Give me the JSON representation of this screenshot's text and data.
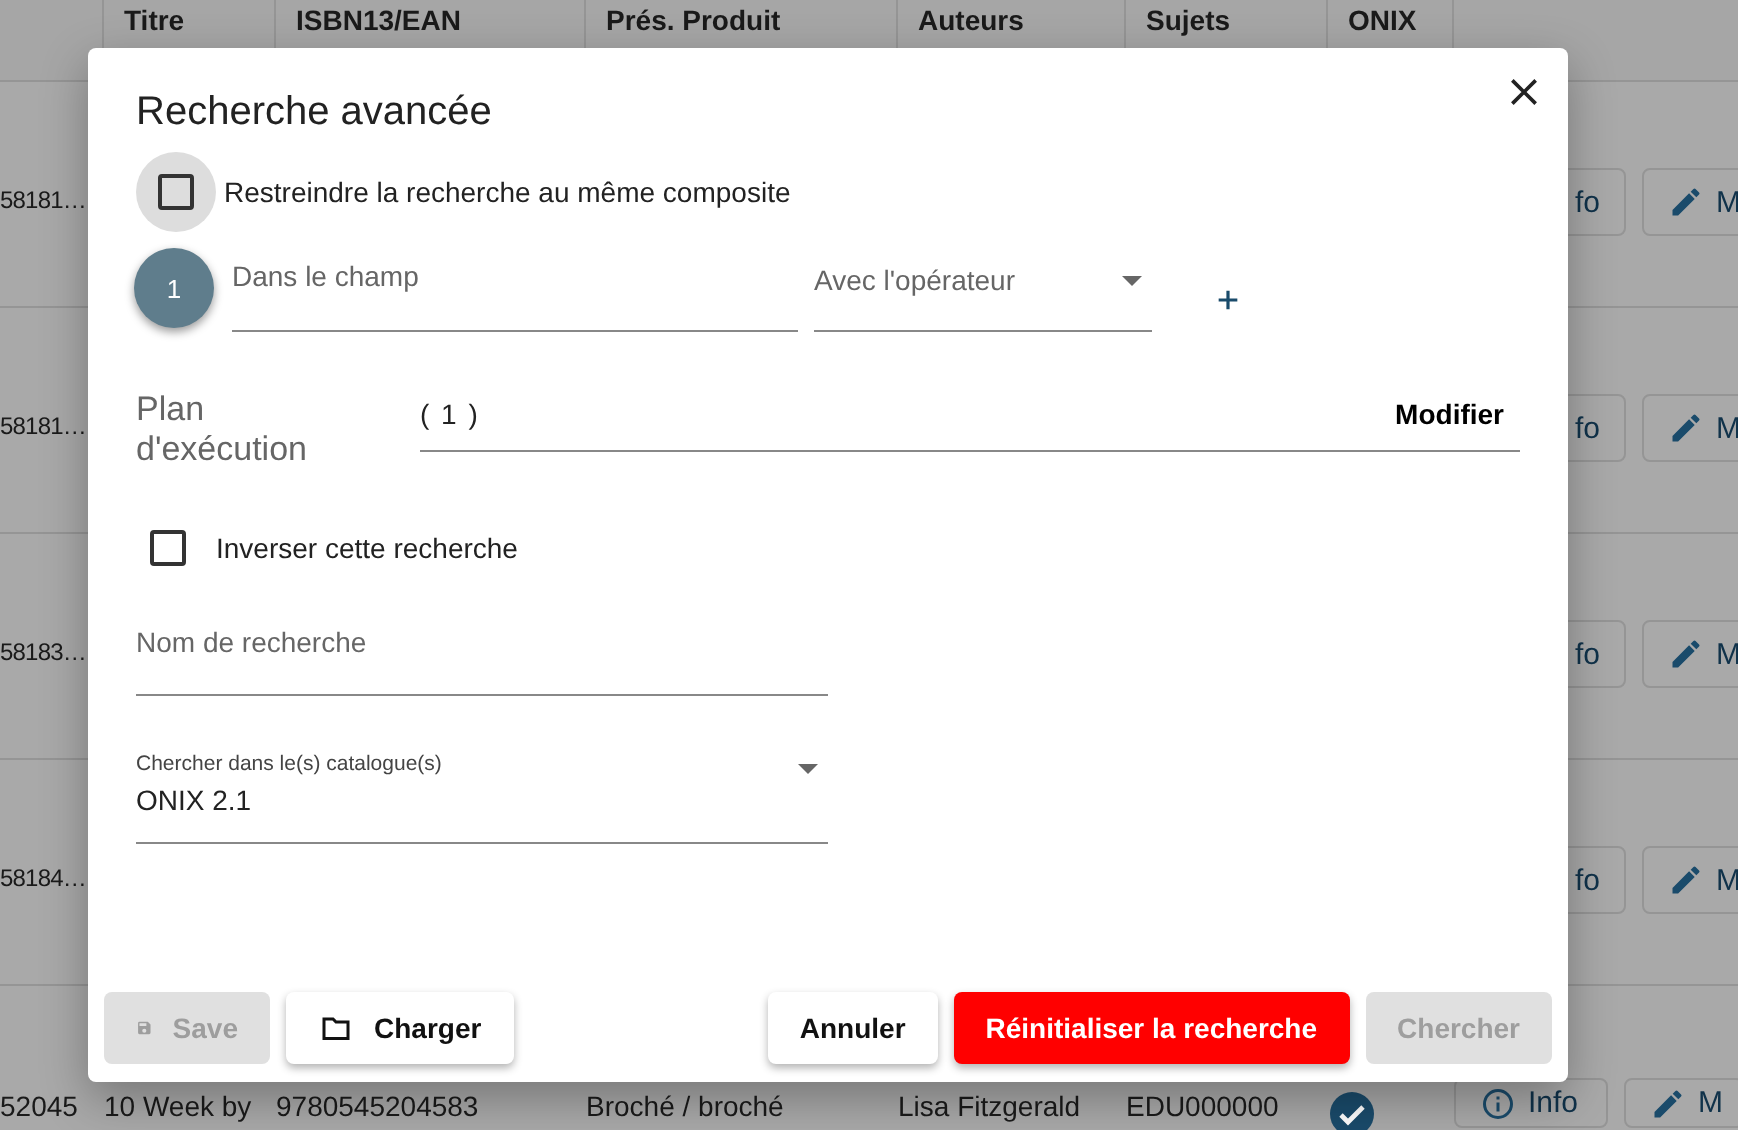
{
  "table": {
    "columns": [
      "Titre",
      "ISBN13/EAN",
      "Prés. Produit",
      "Auteurs",
      "Sujets",
      "ONIX"
    ],
    "rows": [
      {
        "code": "58181…",
        "info_button": "fo",
        "edit_button": "M"
      },
      {
        "code": "58181…",
        "info_button": "fo",
        "edit_button": "M"
      },
      {
        "code": "58183…",
        "info_button": "fo",
        "edit_button": "M"
      },
      {
        "code": "58184…",
        "info_button": "fo",
        "edit_button": "M"
      }
    ],
    "last_row": {
      "cells": [
        "52045",
        "10 Week by",
        "9780545204583",
        "Broché / broché",
        "Lisa Fitzgerald",
        "EDU000000"
      ],
      "onix_checked": true,
      "info_button": "Info",
      "edit_button": "M"
    }
  },
  "dialog": {
    "title": "Recherche avancée",
    "restrict_checkbox": {
      "label": "Restreindre la recherche au même composite",
      "checked": false
    },
    "conditions": [
      {
        "step": "1",
        "field": {
          "placeholder": "Dans le champ"
        },
        "operator_select": {
          "label": "Avec l'opérateur"
        }
      }
    ],
    "plan": {
      "label": "Plan d'exécution",
      "value": "( 1 )",
      "modify_button": "Modifier"
    },
    "invert_checkbox": {
      "label": "Inverser cette recherche",
      "checked": false
    },
    "name_field": {
      "placeholder": "Nom de recherche"
    },
    "catalog_select": {
      "label": "Chercher dans le(s) catalogue(s)",
      "value": "ONIX 2.1"
    },
    "buttons": [
      {
        "label": "Save",
        "kind": "save",
        "disabled": true
      },
      {
        "label": "Charger",
        "kind": "load",
        "disabled": false
      },
      {
        "label": "Annuler",
        "kind": "cancel",
        "disabled": false
      },
      {
        "label": "Réinitialiser la recherche",
        "kind": "reset",
        "disabled": false
      },
      {
        "label": "Chercher",
        "kind": "search",
        "disabled": true
      }
    ]
  }
}
